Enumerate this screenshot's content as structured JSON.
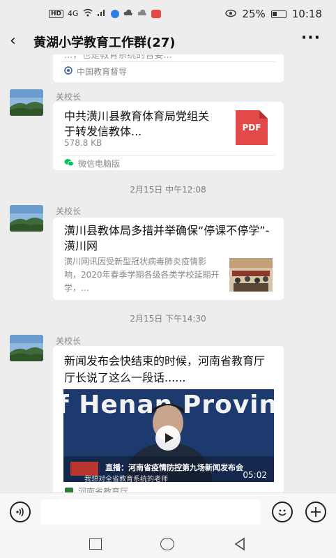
{
  "status_bar": {
    "net_label": "4G",
    "battery": "25%",
    "time": "10:18"
  },
  "header": {
    "back_icon": "‹",
    "title": "黄湖小学教育工作群(27)",
    "more_icon": "···"
  },
  "messages": {
    "m0": {
      "partial_text": "...，也是教育系统的普要...",
      "source": "中国教育督导"
    },
    "m1": {
      "sender": "关校长",
      "title": "中共潢川县教育体育局党组关于转发信教体...",
      "size": "578.8 KB",
      "file_badge": "PDF",
      "source": "微信电脑版"
    },
    "t1": "2月15日 中午12:08",
    "m2": {
      "sender": "关校长",
      "title": "潢川县教体局多措并举确保“停课不停学”-潢川网",
      "desc": "潢川网讯因受新型冠状病毒肺炎疫情影响，2020年春季学期各级各类学校延期开学，...",
      "source": ""
    },
    "t2": "2月15日 下午14:30",
    "m3": {
      "sender": "关校长",
      "title": "新闻发布会快结束的时候，河南省教育厅厅长说了这么一段话......",
      "video_bg_text": "f Henan Provinc",
      "video_caption": "直播：河南省疫情防控第九场新闻发布会",
      "video_subtitle": "我想对全省教育系统的老师",
      "video_duration": "05:02",
      "source": "河南省教育厅"
    }
  },
  "colors": {
    "bg": "#ededed",
    "pdf_red": "#e24a4a",
    "wechat_green": "#07c160"
  }
}
